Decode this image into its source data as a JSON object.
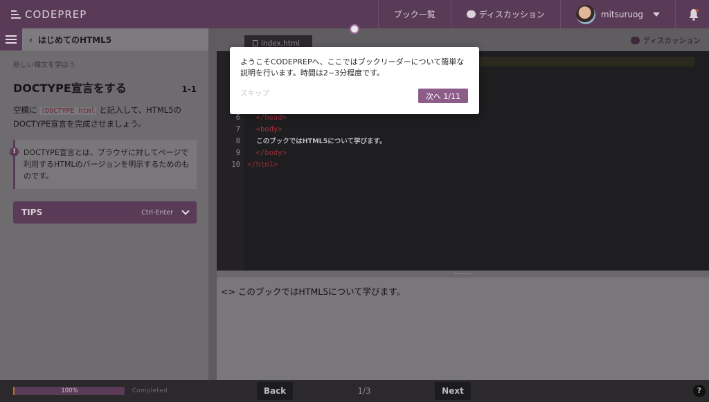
{
  "app": {
    "logo": "CODEPREP"
  },
  "topnav": {
    "book_list": "ブック一覧",
    "discussion": "ディスカッション",
    "username": "mitsuruog"
  },
  "book": {
    "title": "はじめてのHTML5"
  },
  "lesson": {
    "subheading": "新しい構文を学ぼう",
    "title": "DOCTYPE宣言をする",
    "number": "1-1",
    "instruction_pre": "空欄に ",
    "instruction_code": "!DOCTYPE html",
    "instruction_post": " と記入して、HTML5のDOCTYPE宣言を完成させましょう。",
    "note": "DOCTYPE宣言とは、ブラウザに対してページで利用するHTMLのバージョンを明示するためのものです。",
    "note_icon": "!",
    "tips_label": "TIPS",
    "tips_shortcut": "Ctrl-Enter"
  },
  "editor": {
    "file_tab": "index.html",
    "discussion": "ディスカッション",
    "lines": [
      {
        "n": "6",
        "code": "  </head>",
        "kind": "tag"
      },
      {
        "n": "7",
        "code": "  <body>",
        "kind": "tag"
      },
      {
        "n": "8",
        "code": "    このブックではHTML5について学びます。",
        "kind": "text"
      },
      {
        "n": "9",
        "code": "  </body>",
        "kind": "tag"
      },
      {
        "n": "10",
        "code": "</html>",
        "kind": "tag"
      }
    ]
  },
  "preview": {
    "text": "<> このブックではHTML5について学びます。"
  },
  "footer": {
    "progress_label": "100%",
    "progress": 1.0,
    "completed": "Completed",
    "back": "Back",
    "pager": "1/3",
    "next": "Next",
    "help": "?"
  },
  "modal": {
    "text": "ようこそCODEPREPへ、ここではブックリーダーについて簡単な説明を行います。時間は2~3分程度です。",
    "skip": "スキップ",
    "next": "次へ 1/11"
  },
  "colors": {
    "brand": "#5a3b57",
    "accent": "#8d5d89",
    "tag": "#9b2f3b"
  }
}
